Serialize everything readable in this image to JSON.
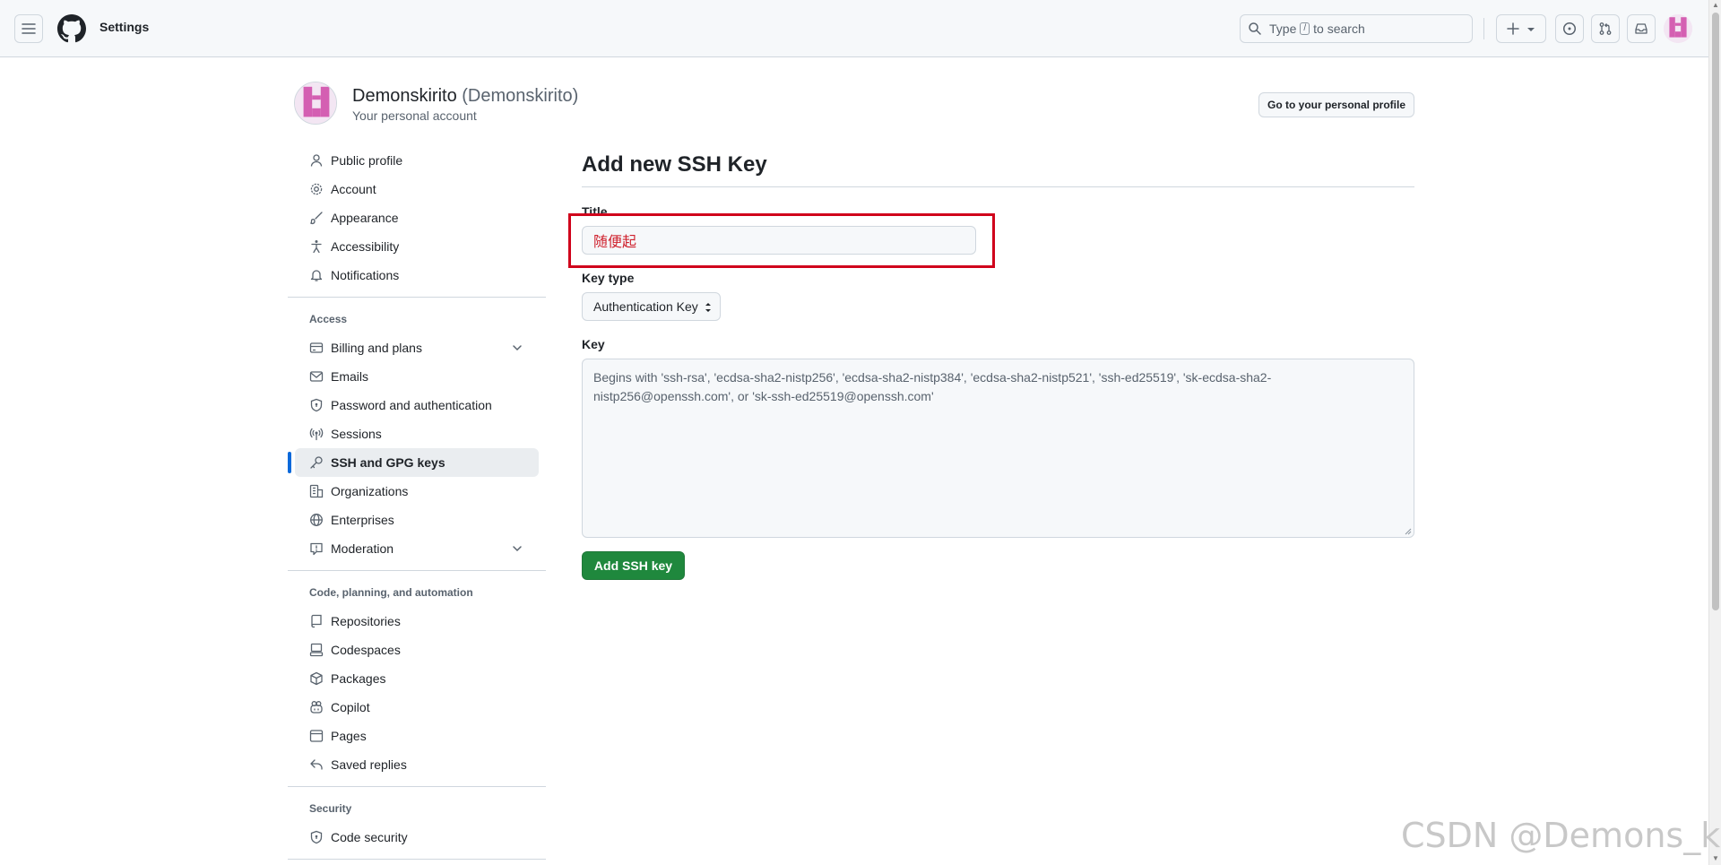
{
  "header": {
    "context": "Settings",
    "search": {
      "pre": "Type",
      "key": "/",
      "post": "to search"
    }
  },
  "account": {
    "name": "Demonskirito",
    "login": "(Demonskirito)",
    "subtitle": "Your personal account",
    "profile_button": "Go to your personal profile",
    "avatar_color": "#d45fb2"
  },
  "sidebar": {
    "group1": [
      {
        "label": "Public profile",
        "icon": "person-icon"
      },
      {
        "label": "Account",
        "icon": "gear-icon"
      },
      {
        "label": "Appearance",
        "icon": "paintbrush-icon"
      },
      {
        "label": "Accessibility",
        "icon": "accessibility-icon"
      },
      {
        "label": "Notifications",
        "icon": "bell-icon"
      }
    ],
    "access_heading": "Access",
    "access": [
      {
        "label": "Billing and plans",
        "icon": "credit-card-icon"
      },
      {
        "label": "Emails",
        "icon": "mail-icon"
      },
      {
        "label": "Password and authentication",
        "icon": "shield-lock-icon"
      },
      {
        "label": "Sessions",
        "icon": "broadcast-icon"
      },
      {
        "label": "SSH and GPG keys",
        "icon": "key-icon"
      },
      {
        "label": "Organizations",
        "icon": "organization-icon"
      },
      {
        "label": "Enterprises",
        "icon": "globe-icon"
      },
      {
        "label": "Moderation",
        "icon": "report-icon"
      }
    ],
    "code_heading": "Code, planning, and automation",
    "code": [
      {
        "label": "Repositories",
        "icon": "repo-icon"
      },
      {
        "label": "Codespaces",
        "icon": "codespaces-icon"
      },
      {
        "label": "Packages",
        "icon": "package-icon"
      },
      {
        "label": "Copilot",
        "icon": "copilot-icon"
      },
      {
        "label": "Pages",
        "icon": "browser-icon"
      },
      {
        "label": "Saved replies",
        "icon": "reply-icon"
      }
    ],
    "security_heading": "Security",
    "security": [
      {
        "label": "Code security",
        "icon": "shield-lock-icon"
      }
    ]
  },
  "main": {
    "title": "Add new SSH Key",
    "title_label": "Title",
    "title_value": "随便起",
    "key_type_label": "Key type",
    "key_type_value": "Authentication Key",
    "key_label": "Key",
    "key_placeholder": "Begins with 'ssh-rsa', 'ecdsa-sha2-nistp256', 'ecdsa-sha2-nistp384', 'ecdsa-sha2-nistp521', 'ssh-ed25519', 'sk-ecdsa-sha2-nistp256@openssh.com', or 'sk-ssh-ed25519@openssh.com'",
    "submit_label": "Add SSH key"
  },
  "watermark": "CSDN @Demons_kirit",
  "colors": {
    "highlight": "#d0021b",
    "primary_button": "#1f883d",
    "active_indicator": "#0969da"
  }
}
